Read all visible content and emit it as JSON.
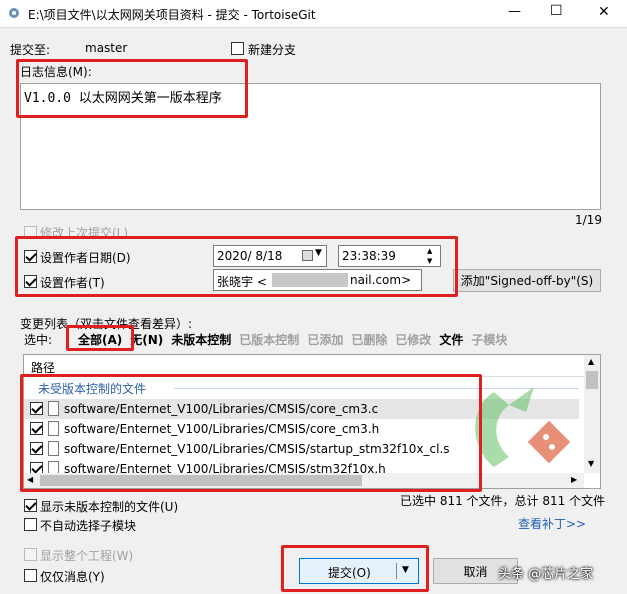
{
  "window": {
    "title": "E:\\项目文件\\以太网网关项目资料 - 提交 - TortoiseGit",
    "minimize": "—",
    "maximize": "☐",
    "close": "✕"
  },
  "commit_to": {
    "label": "提交至:",
    "branch": "master"
  },
  "new_branch": {
    "label": "新建分支",
    "checked": false
  },
  "log": {
    "label": "日志信息(M):",
    "text": "V1.0.0 以太网网关第一版本程序",
    "counter": "1/19"
  },
  "amend": {
    "label": "修改上次提交(L)",
    "checked": false
  },
  "author_date": {
    "label": "设置作者日期(D)",
    "checked": true,
    "date": "2020/ 8/18",
    "time": "23:38:39"
  },
  "author": {
    "label": "设置作者(T)",
    "checked": true,
    "value_prefix": "张晓宇 <",
    "value_suffix": "nail.com>"
  },
  "signed_off_button": "添加\"Signed-off-by\"(S)",
  "changes": {
    "label": "变更列表（双击文件查看差异）:",
    "select_label": "选中:",
    "filters": [
      {
        "label": "全部(A)",
        "style": "bold"
      },
      {
        "label": "无(N)",
        "style": "bold"
      },
      {
        "label": "未版本控制",
        "style": "bold"
      },
      {
        "label": "已版本控制",
        "style": "gray"
      },
      {
        "label": "已添加",
        "style": "gray"
      },
      {
        "label": "已删除",
        "style": "gray"
      },
      {
        "label": "已修改",
        "style": "gray"
      },
      {
        "label": "文件",
        "style": "bold"
      },
      {
        "label": "子模块",
        "style": "gray"
      }
    ],
    "column_path": "路径",
    "group_header": "未受版本控制的文件",
    "files": [
      {
        "path": "software/Enternet_V100/Libraries/CMSIS/core_cm3.c",
        "checked": true
      },
      {
        "path": "software/Enternet_V100/Libraries/CMSIS/core_cm3.h",
        "checked": true
      },
      {
        "path": "software/Enternet_V100/Libraries/CMSIS/startup_stm32f10x_cl.s",
        "checked": true
      },
      {
        "path": "software/Enternet_V100/Libraries/CMSIS/stm32f10x.h",
        "checked": true
      }
    ]
  },
  "show_unversioned": {
    "label": "显示未版本控制的文件(U)",
    "checked": true
  },
  "no_auto_submodule": {
    "label": "不自动选择子模块",
    "checked": false
  },
  "summary": "已选中 811 个文件，总计 811 个文件",
  "view_patch": "查看补丁>>",
  "show_whole_project": {
    "label": "显示整个工程(W)",
    "checked": false
  },
  "message_only": {
    "label": "仅仅消息(Y)",
    "checked": false
  },
  "commit_button": "提交(O)",
  "cancel_button": "取消",
  "watermark": "头条 @芯片之家"
}
